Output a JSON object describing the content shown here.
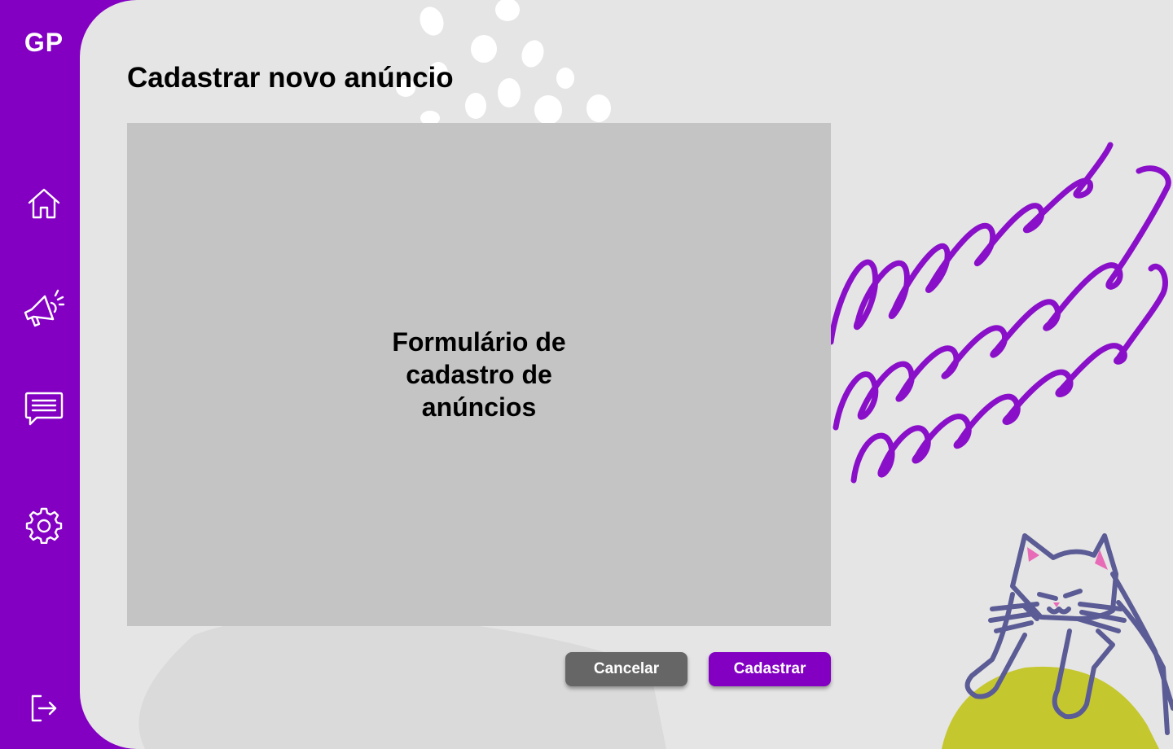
{
  "app": {
    "logo": "GP"
  },
  "sidebar": {
    "items": [
      {
        "id": "home",
        "icon": "home-icon"
      },
      {
        "id": "ads",
        "icon": "megaphone-icon"
      },
      {
        "id": "messages",
        "icon": "chat-icon"
      },
      {
        "id": "settings",
        "icon": "gear-icon"
      },
      {
        "id": "logout",
        "icon": "logout-icon"
      }
    ]
  },
  "main": {
    "title": "Cadastrar novo anúncio",
    "form_placeholder": "Formulário de cadastro de anúncios",
    "buttons": {
      "cancel": "Cancelar",
      "submit": "Cadastrar"
    }
  },
  "colors": {
    "brand": "#8300c3",
    "background": "#e5e5e5",
    "placeholder": "#c4c4c4",
    "cancel_button": "#666666",
    "cat_outline": "#5b5b95",
    "cat_ears": "#e86bb8",
    "blob": "#c5c72e"
  }
}
